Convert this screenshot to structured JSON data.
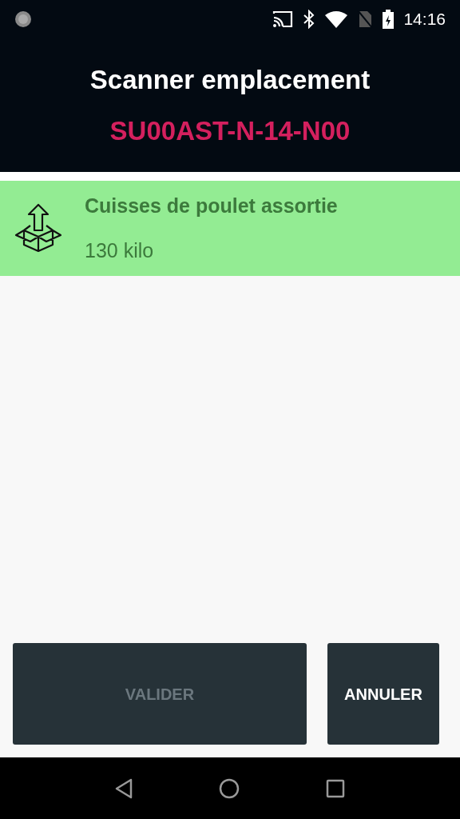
{
  "status_bar": {
    "time": "14:16"
  },
  "header": {
    "title": "Scanner emplacement",
    "location": "SU00AST-N-14-N00"
  },
  "items": [
    {
      "name": "Cuisses de poulet assortie",
      "quantity": "130 kilo"
    }
  ],
  "buttons": [
    {
      "label": "VALIDER",
      "disabled": true
    },
    {
      "label": "ANNULER",
      "disabled": false
    }
  ]
}
